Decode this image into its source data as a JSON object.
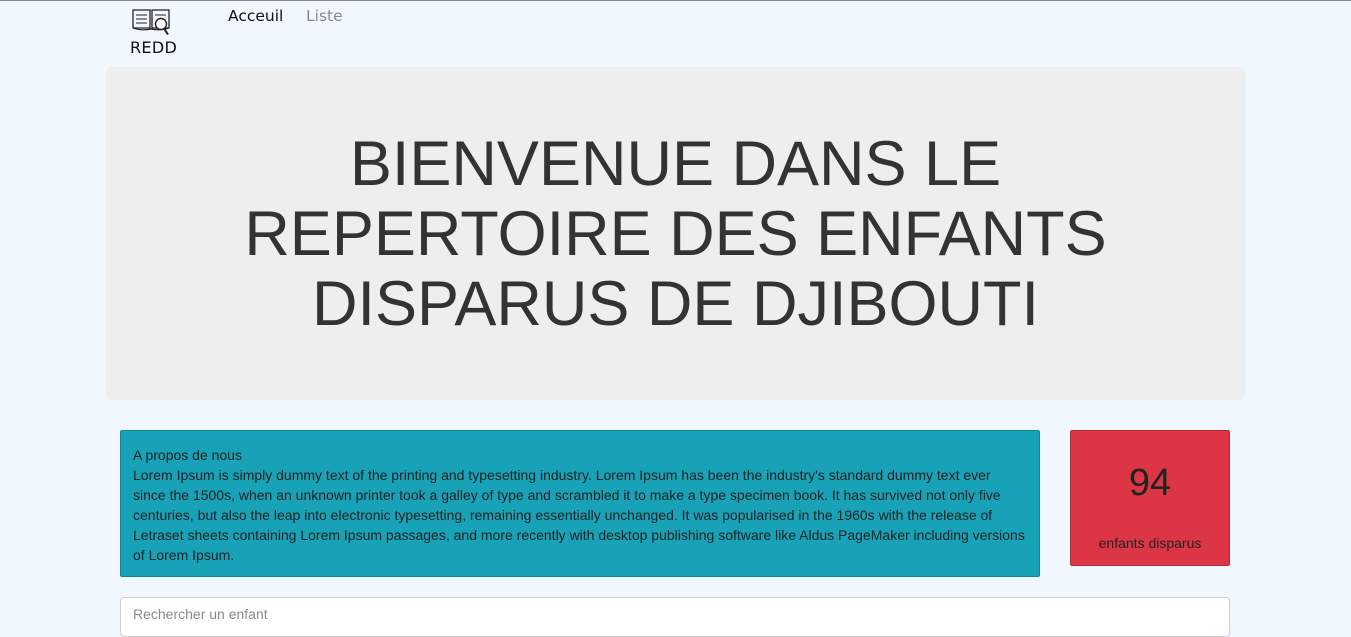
{
  "navbar": {
    "brand": {
      "icon": "book-magnifier-icon",
      "label": "REDD"
    },
    "links": [
      {
        "label": "Acceuil",
        "active": true
      },
      {
        "label": "Liste",
        "active": false
      }
    ]
  },
  "hero": {
    "title": "BIENVENUE DANS LE REPERTOIRE DES ENFANTS DISPARUS DE DJIBOUTI"
  },
  "about": {
    "title": "A propos de nous",
    "text": "Lorem Ipsum is simply dummy text of the printing and typesetting industry. Lorem Ipsum has been the industry's standard dummy text ever since the 1500s, when an unknown printer took a galley of type and scrambled it to make a type specimen book. It has survived not only five centuries, but also the leap into electronic typesetting, remaining essentially unchanged. It was popularised in the 1960s with the release of Letraset sheets containing Lorem Ipsum passages, and more recently with desktop publishing software like Aldus PageMaker including versions of Lorem Ipsum.",
    "color": "#17a2b8"
  },
  "counter": {
    "value": "94",
    "label": "enfants disparus",
    "color": "#dc3545"
  },
  "search": {
    "placeholder": "Rechercher un enfant",
    "value": ""
  }
}
